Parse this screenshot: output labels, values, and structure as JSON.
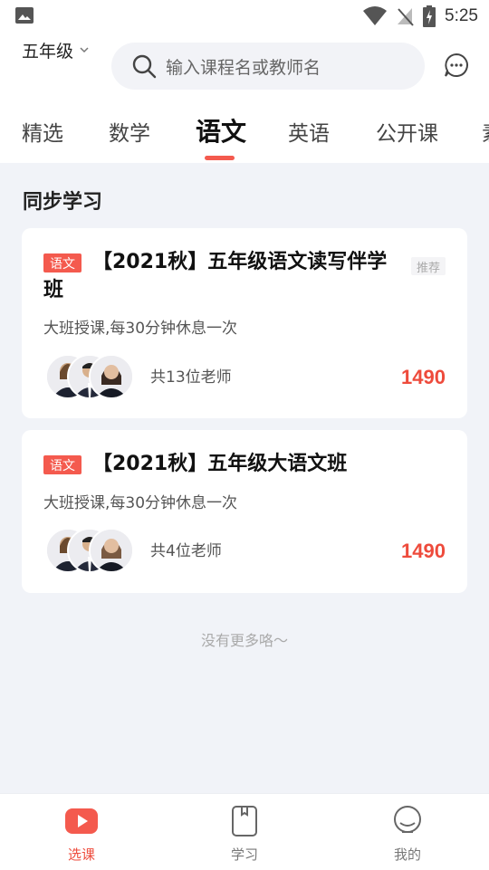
{
  "status_bar": {
    "time": "5:25"
  },
  "header": {
    "grade": "五年级",
    "search_placeholder": "输入课程名或教师名"
  },
  "tabs": [
    {
      "label": "精选"
    },
    {
      "label": "数学"
    },
    {
      "label": "语文",
      "active": true
    },
    {
      "label": "英语"
    },
    {
      "label": "公开课"
    },
    {
      "label": "素"
    }
  ],
  "section": {
    "title": "同步学习"
  },
  "courses": [
    {
      "subject": "语文",
      "title": "【2021秋】五年级语文读写伴学班",
      "tag": "推荐",
      "description": "大班授课,每30分钟休息一次",
      "teachers": "共13位老师",
      "price": "1490"
    },
    {
      "subject": "语文",
      "title": "【2021秋】五年级大语文班",
      "description": "大班授课,每30分钟休息一次",
      "teachers": "共4位老师",
      "price": "1490"
    }
  ],
  "no_more": "没有更多咯～",
  "bottom_nav": [
    {
      "label": "选课",
      "icon": "play-icon",
      "active": true
    },
    {
      "label": "学习",
      "icon": "book-icon"
    },
    {
      "label": "我的",
      "icon": "profile-icon"
    }
  ],
  "colors": {
    "accent": "#f45a4e",
    "price": "#ee4b3c",
    "background": "#f1f3f8"
  }
}
